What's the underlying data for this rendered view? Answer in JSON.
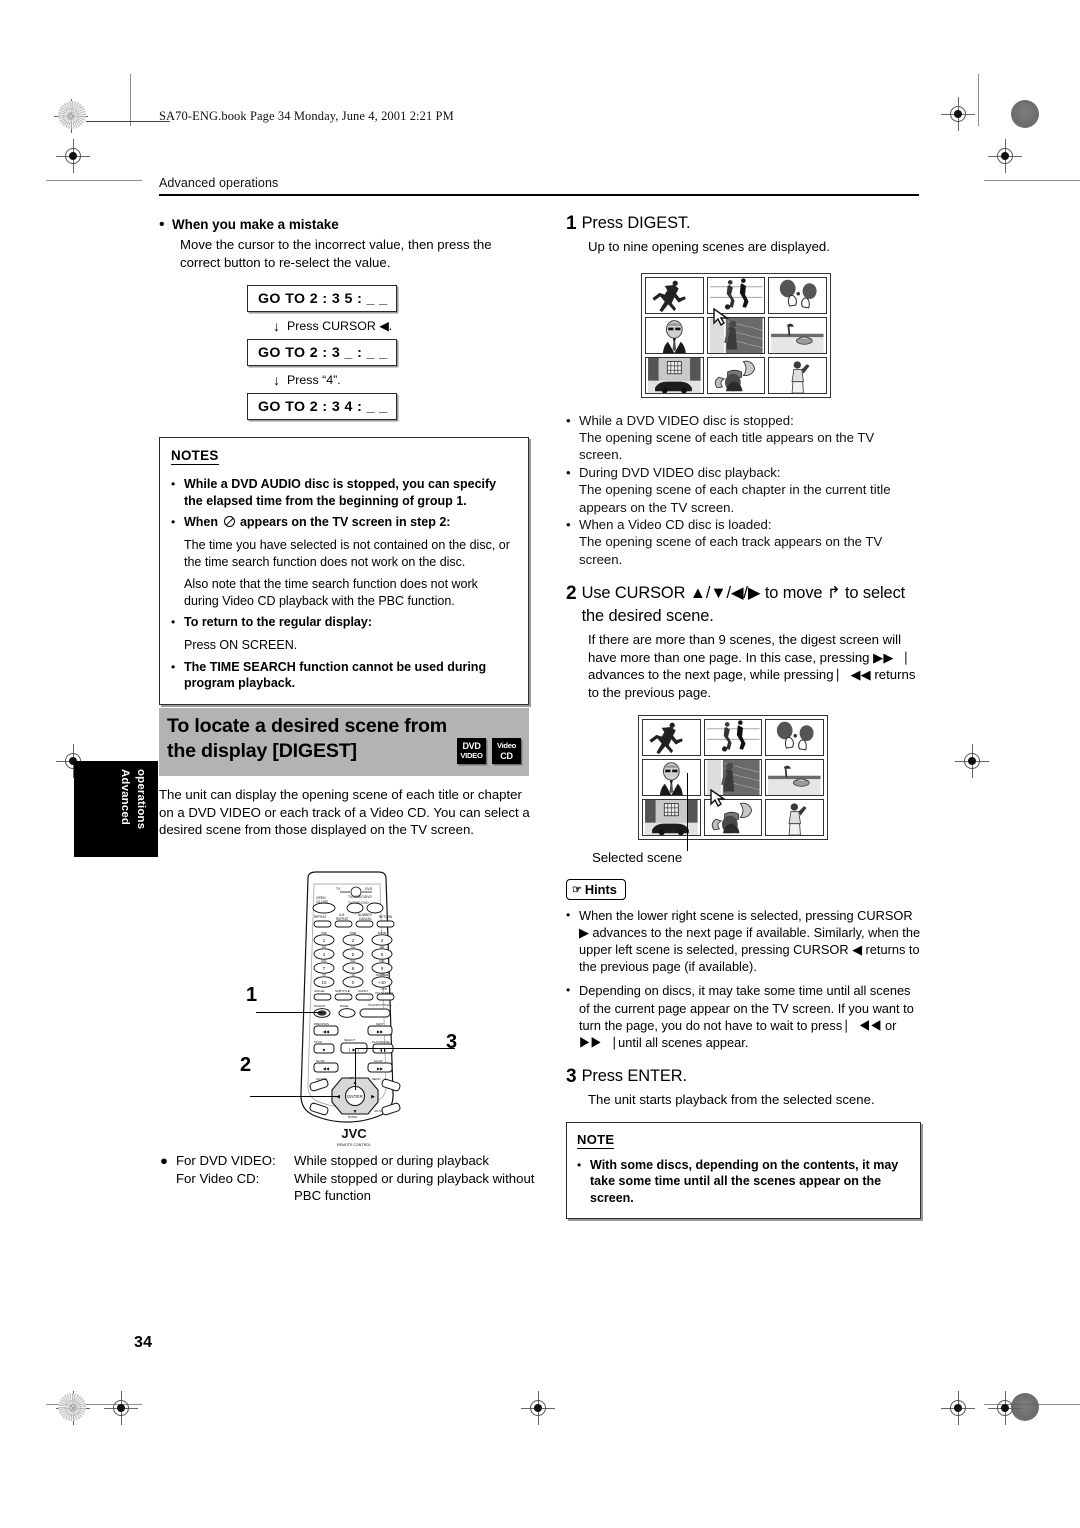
{
  "page": {
    "file_header": "SA70-ENG.book  Page 34  Monday, June 4, 2001  2:21 PM",
    "running_head": "Advanced operations",
    "page_number": "34",
    "side_tab_line1": "Advanced",
    "side_tab_line2": "operations"
  },
  "left": {
    "mistake_heading": "When you make a mistake",
    "mistake_body": "Move the cursor to the incorrect value, then press the correct button to re-select the value.",
    "goto_steps": [
      {
        "display": "GO TO  2 : 3 5 : _ _",
        "action": "Press CURSOR ◀."
      },
      {
        "display": "GO TO  2 : 3 _ : _ _",
        "action": "Press “4”."
      },
      {
        "display": "GO TO  2 : 3 4 : _ _",
        "action": ""
      }
    ],
    "notes_title": "NOTES",
    "notes": [
      {
        "bold": true,
        "text": "While a DVD AUDIO disc is stopped, you can specify the elapsed time from the beginning of group 1."
      },
      {
        "bold": true,
        "text": "When ⊘ appears on the TV screen in step 2:"
      },
      {
        "sub": true,
        "text": "The time you have selected is not contained on the disc, or the time search function does not work on the disc."
      },
      {
        "sub": true,
        "text": "Also note that the time search function does not work during Video CD playback with the PBC function."
      },
      {
        "bold": true,
        "text": "To return to the regular display:"
      },
      {
        "sub": true,
        "text": "Press ON SCREEN."
      },
      {
        "bold": true,
        "text": "The TIME SEARCH function cannot be used during program playback."
      }
    ],
    "section_title": "To locate a desired scene from the display [DIGEST]",
    "logos": [
      {
        "line1": "DVD",
        "line2": "VIDEO"
      },
      {
        "line1": "Video",
        "line2": "CD"
      }
    ],
    "intro": "The unit can display the opening scene of each title or chapter on a DVD VIDEO or each track of a Video CD.  You can select a desired scene from those displayed on the TV screen.",
    "remote_callouts": [
      "1",
      "2",
      "3"
    ],
    "remote_brand": "JVC",
    "remote_sub": "REMOTE CONTROL",
    "availability": [
      {
        "label": "For DVD VIDEO:",
        "value": "While stopped or during playback"
      },
      {
        "label": "For Video CD:",
        "value": "While stopped or during playback without PBC function"
      }
    ]
  },
  "right": {
    "step1": {
      "num": "1",
      "title": "Press DIGEST.",
      "body": "Up to nine opening scenes are displayed."
    },
    "step1_bullets": [
      {
        "head": "While a DVD VIDEO disc is stopped:",
        "text": "The opening scene of each title appears on the TV screen."
      },
      {
        "head": "During DVD VIDEO disc playback:",
        "text": "The opening scene of each chapter in the current title appears on the TV screen."
      },
      {
        "head": "When a Video CD disc is loaded:",
        "text": "The opening scene of each track appears on the TV screen."
      }
    ],
    "step2": {
      "num": "2",
      "title": "Use CURSOR ▲/▼/◀/▶ to move ↱ to select the desired scene.",
      "body": "If there are more than 9 scenes, the digest screen will have more than one page. In this case, pressing ▶▶⎹ advances to the next page, while pressing ⎸◀◀ returns to the previous page."
    },
    "selected_scene_label": "Selected scene",
    "hints_label": "Hints",
    "hints": [
      "When the lower right scene is selected, pressing CURSOR ▶ advances to the next page if available. Similarly, when the upper left scene is selected, pressing CURSOR ◀ returns to the previous page (if available).",
      "Depending on discs, it may take some time until all scenes of the current page appear on the TV screen. If you want to turn the page, you do not have to wait to press ⎸◀◀ or ▶▶⎹ until all scenes appear."
    ],
    "step3": {
      "num": "3",
      "title": "Press ENTER.",
      "body": "The unit starts playback from the selected scene."
    },
    "note_title": "NOTE",
    "note_items": [
      "With some discs, depending on the contents, it may take some time until all the scenes appear on the screen."
    ]
  },
  "colors": {
    "title_bar": "#b3b3b3",
    "tab_bg": "#000000",
    "text": "#111111"
  }
}
